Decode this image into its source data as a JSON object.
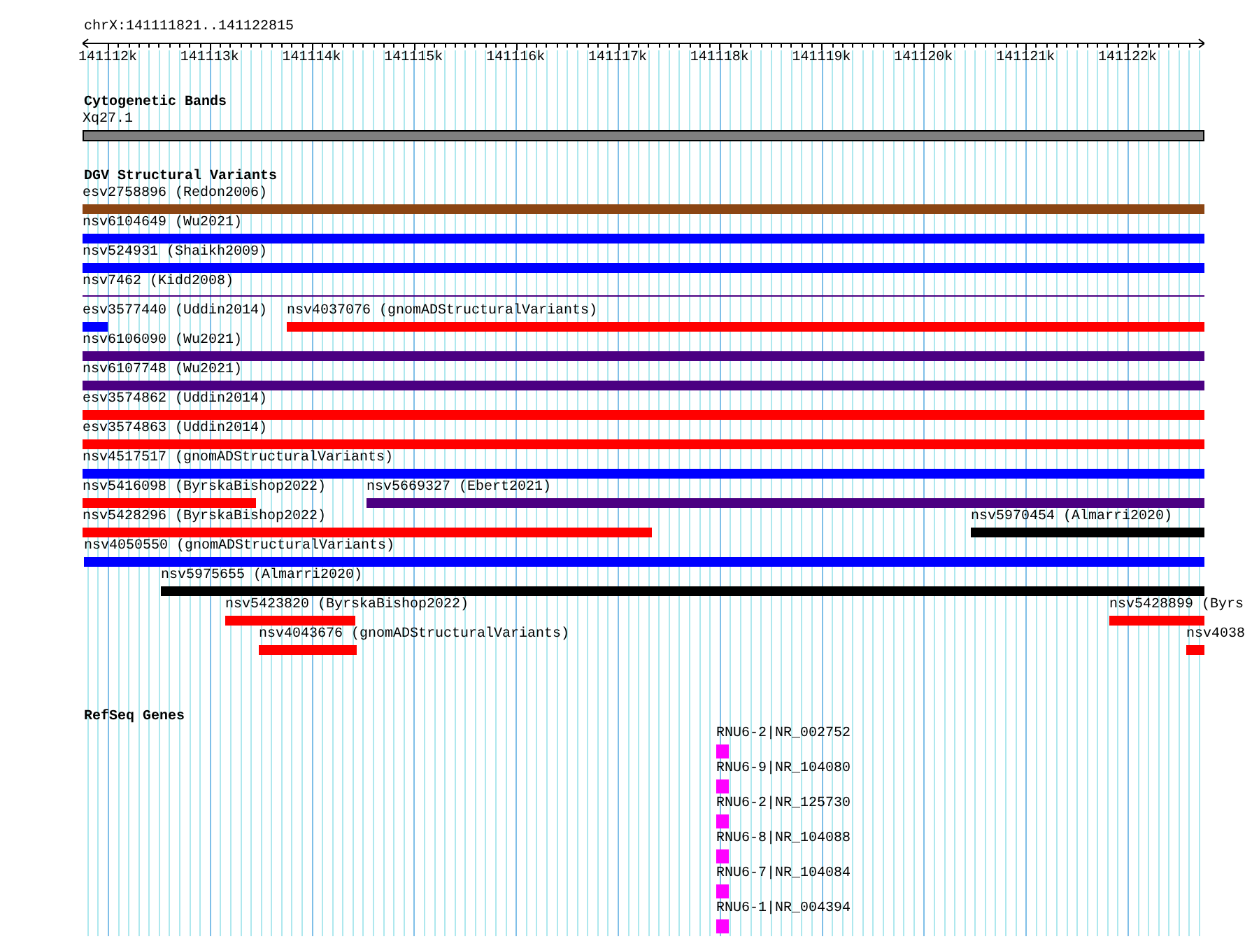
{
  "location": "chrX:141111821..141122815",
  "ruler": {
    "ticks": [
      "141112k",
      "141113k",
      "141114k",
      "141115k",
      "141116k",
      "141117k",
      "141118k",
      "141119k",
      "141120k",
      "141121k",
      "141122k"
    ]
  },
  "tracks": [
    {
      "title": "Cytogenetic Bands",
      "kind": "bands",
      "rows": [
        [
          {
            "label": "Xq27.1",
            "color": "#808080",
            "kind": "band"
          }
        ]
      ]
    },
    {
      "title": "DGV Structural Variants",
      "kind": "features",
      "rows": [
        [
          {
            "label": "esv2758896 (Redon2006)",
            "color": "#8b4513",
            "kind": "bar"
          }
        ],
        [
          {
            "label": "nsv6104649 (Wu2021)",
            "color": "#0000ff",
            "kind": "bar"
          }
        ],
        [
          {
            "label": "nsv524931 (Shaikh2009)",
            "color": "#0000ff",
            "kind": "bar"
          }
        ],
        [
          {
            "label": "nsv7462 (Kidd2008)",
            "color": "#4b0082",
            "kind": "line"
          }
        ],
        [
          {
            "label": "esv3577440 (Uddin2014)",
            "color": "#0000ff",
            "kind": "bar"
          },
          {
            "label": "nsv4037076 (gnomADStructuralVariants)",
            "color": "#ff0000",
            "kind": "bar"
          }
        ],
        [
          {
            "label": "nsv6106090 (Wu2021)",
            "color": "#4b0082",
            "kind": "bar"
          }
        ],
        [
          {
            "label": "nsv6107748 (Wu2021)",
            "color": "#4b0082",
            "kind": "bar"
          }
        ],
        [
          {
            "label": "esv3574862 (Uddin2014)",
            "color": "#ff0000",
            "kind": "bar"
          }
        ],
        [
          {
            "label": "esv3574863 (Uddin2014)",
            "color": "#ff0000",
            "kind": "bar"
          }
        ],
        [
          {
            "label": "nsv4517517 (gnomADStructuralVariants)",
            "color": "#0000ff",
            "kind": "bar"
          }
        ],
        [
          {
            "label": "nsv5416098 (ByrskaBishop2022)",
            "color": "#ff0000",
            "kind": "bar"
          },
          {
            "label": "nsv5669327 (Ebert2021)",
            "color": "#4b0082",
            "kind": "bar"
          }
        ],
        [
          {
            "label": "nsv5428296 (ByrskaBishop2022)",
            "color": "#ff0000",
            "kind": "bar"
          },
          {
            "label": "nsv5970454 (Almarri2020)",
            "color": "#000000",
            "kind": "bar"
          }
        ],
        [
          {
            "label": "nsv4050550 (gnomADStructuralVariants)",
            "color": "#0000ff",
            "kind": "bar"
          }
        ],
        [
          {
            "label": "nsv5975655 (Almarri2020)",
            "color": "#000000",
            "kind": "bar"
          }
        ],
        [
          {
            "label": "nsv5423820 (ByrskaBishop2022)",
            "color": "#ff0000",
            "kind": "bar"
          },
          {
            "label": "nsv5428899 (Byrs",
            "color": "#ff0000",
            "kind": "bar"
          }
        ],
        [
          {
            "label": "nsv4043676 (gnomADStructuralVariants)",
            "color": "#ff0000",
            "kind": "bar"
          },
          {
            "label": "nsv4038",
            "color": "#ff0000",
            "kind": "bar"
          }
        ]
      ]
    },
    {
      "title": "RefSeq Genes",
      "kind": "genes",
      "rows": [
        [
          {
            "label": "RNU6-2|NR_002752",
            "color": "#ff00ff",
            "kind": "gene"
          }
        ],
        [
          {
            "label": "RNU6-9|NR_104080",
            "color": "#ff00ff",
            "kind": "gene"
          }
        ],
        [
          {
            "label": "RNU6-2|NR_125730",
            "color": "#ff00ff",
            "kind": "gene"
          }
        ],
        [
          {
            "label": "RNU6-8|NR_104088",
            "color": "#ff00ff",
            "kind": "gene"
          }
        ],
        [
          {
            "label": "RNU6-7|NR_104084",
            "color": "#ff00ff",
            "kind": "gene"
          }
        ],
        [
          {
            "label": "RNU6-1|NR_004394",
            "color": "#ff00ff",
            "kind": "gene"
          }
        ]
      ]
    }
  ]
}
